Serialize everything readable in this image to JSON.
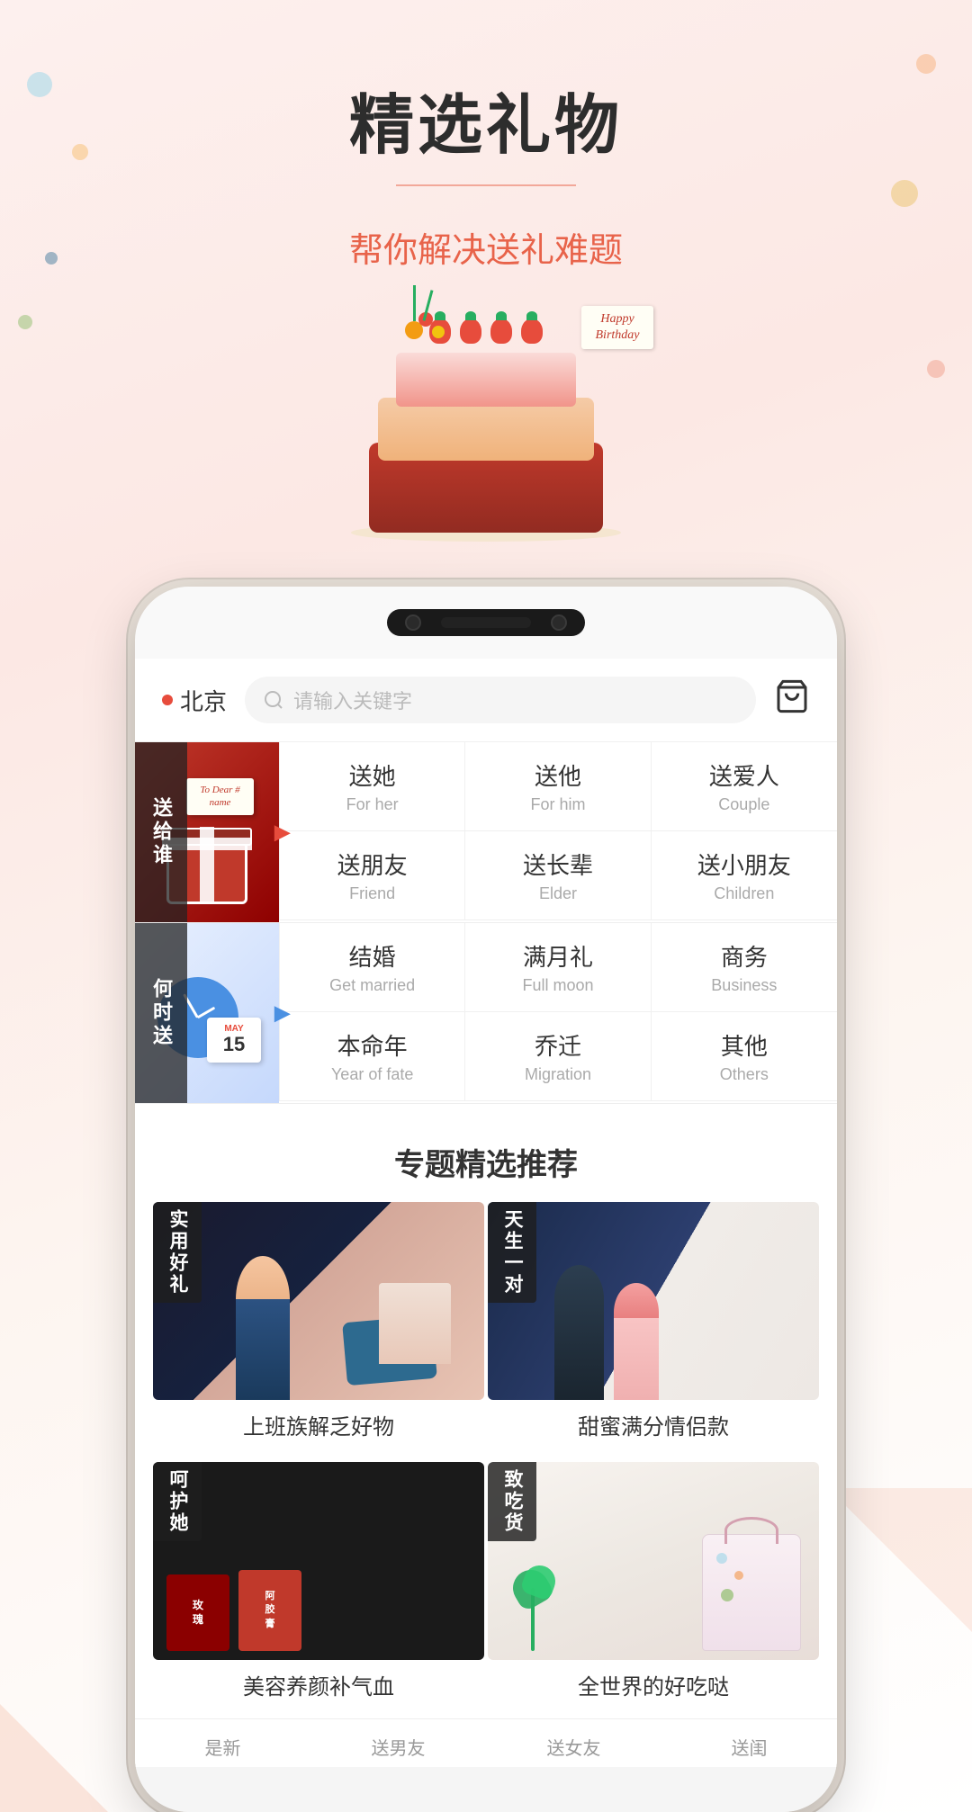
{
  "hero": {
    "title": "精选礼物",
    "subtitle": "帮你解决送礼难题",
    "cake_card_text": "Happy Birthday"
  },
  "phone": {
    "header": {
      "location": "北京",
      "search_placeholder": "请输入关键字"
    },
    "category1": {
      "label": "送给谁",
      "items": [
        {
          "main": "送她",
          "sub": "For her"
        },
        {
          "main": "送他",
          "sub": "For him"
        },
        {
          "main": "送爱人",
          "sub": "Couple"
        },
        {
          "main": "送朋友",
          "sub": "Friend"
        },
        {
          "main": "送长辈",
          "sub": "Elder"
        },
        {
          "main": "送小朋友",
          "sub": "Children"
        }
      ]
    },
    "category2": {
      "label": "何时送",
      "items": [
        {
          "main": "结婚",
          "sub": "Get married"
        },
        {
          "main": "满月礼",
          "sub": "Full moon"
        },
        {
          "main": "商务",
          "sub": "Business"
        },
        {
          "main": "本命年",
          "sub": "Year of fate"
        },
        {
          "main": "乔迁",
          "sub": "Migration"
        },
        {
          "main": "其他",
          "sub": "Others"
        }
      ]
    },
    "section": {
      "title": "专题精选推荐"
    },
    "products": [
      {
        "badge": "实用好礼",
        "label": "上班族解乏好物"
      },
      {
        "badge": "天生一对",
        "label": "甜蜜满分情侣款"
      },
      {
        "badge": "呵护她",
        "label": "美容养颜补气血"
      },
      {
        "badge": "致吃货",
        "label": "全世界的好吃哒"
      }
    ],
    "bottom_tabs": [
      {
        "label": "是新"
      },
      {
        "label": "送男友"
      },
      {
        "label": "送女友"
      },
      {
        "label": "送闺"
      }
    ]
  }
}
